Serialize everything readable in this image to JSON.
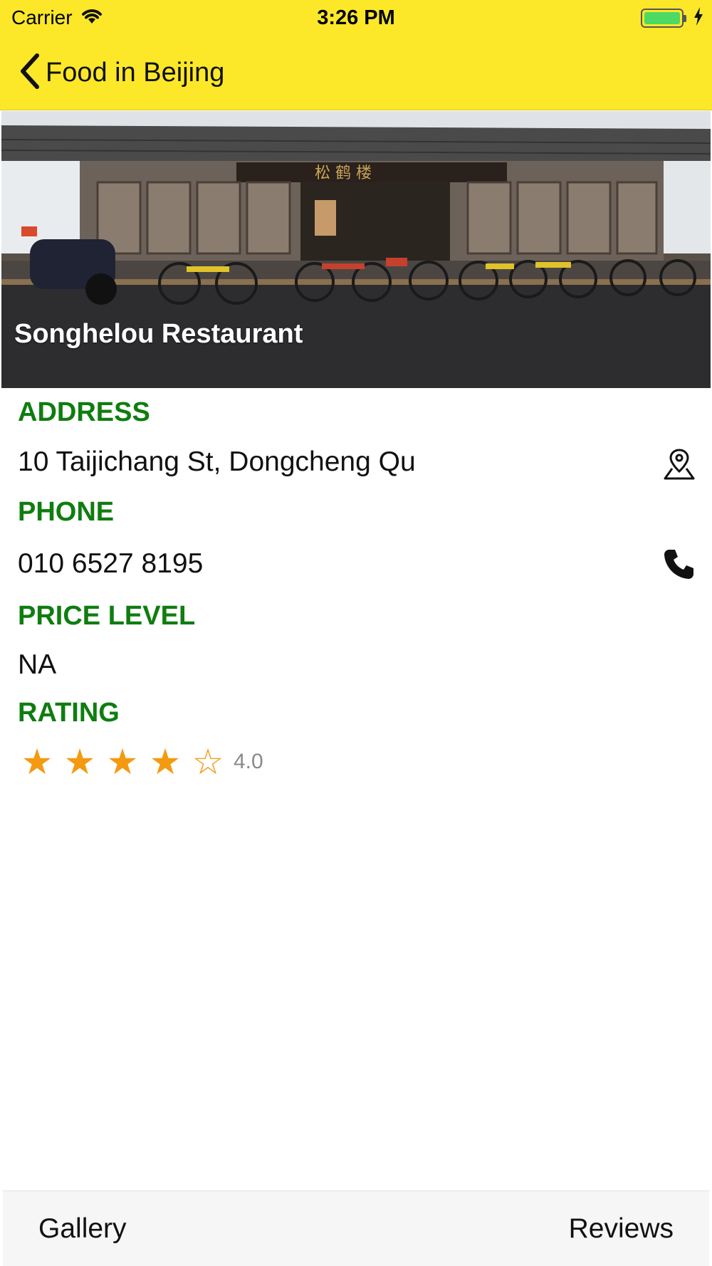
{
  "status_bar": {
    "carrier": "Carrier",
    "time": "3:26 PM",
    "battery_color": "#4cd964"
  },
  "nav": {
    "back_label": "Food in Beijing",
    "background": "#fce828"
  },
  "hero": {
    "title": "Songhelou Restaurant",
    "image_icon": "restaurant-photo"
  },
  "details": {
    "address_heading": "ADDRESS",
    "address_value": "10 Taijichang St, Dongcheng Qu",
    "address_icon": "map-pin-icon",
    "phone_heading": "PHONE",
    "phone_value": "010 6527 8195",
    "phone_icon": "phone-icon",
    "price_heading": "PRICE LEVEL",
    "price_value": "NA",
    "rating_heading": "RATING",
    "rating_value": "4.0",
    "rating_stars_filled": 4,
    "rating_stars_total": 5,
    "heading_color": "#0f7d0f",
    "star_color": "#f39a10"
  },
  "toolbar": {
    "gallery_label": "Gallery",
    "reviews_label": "Reviews"
  }
}
